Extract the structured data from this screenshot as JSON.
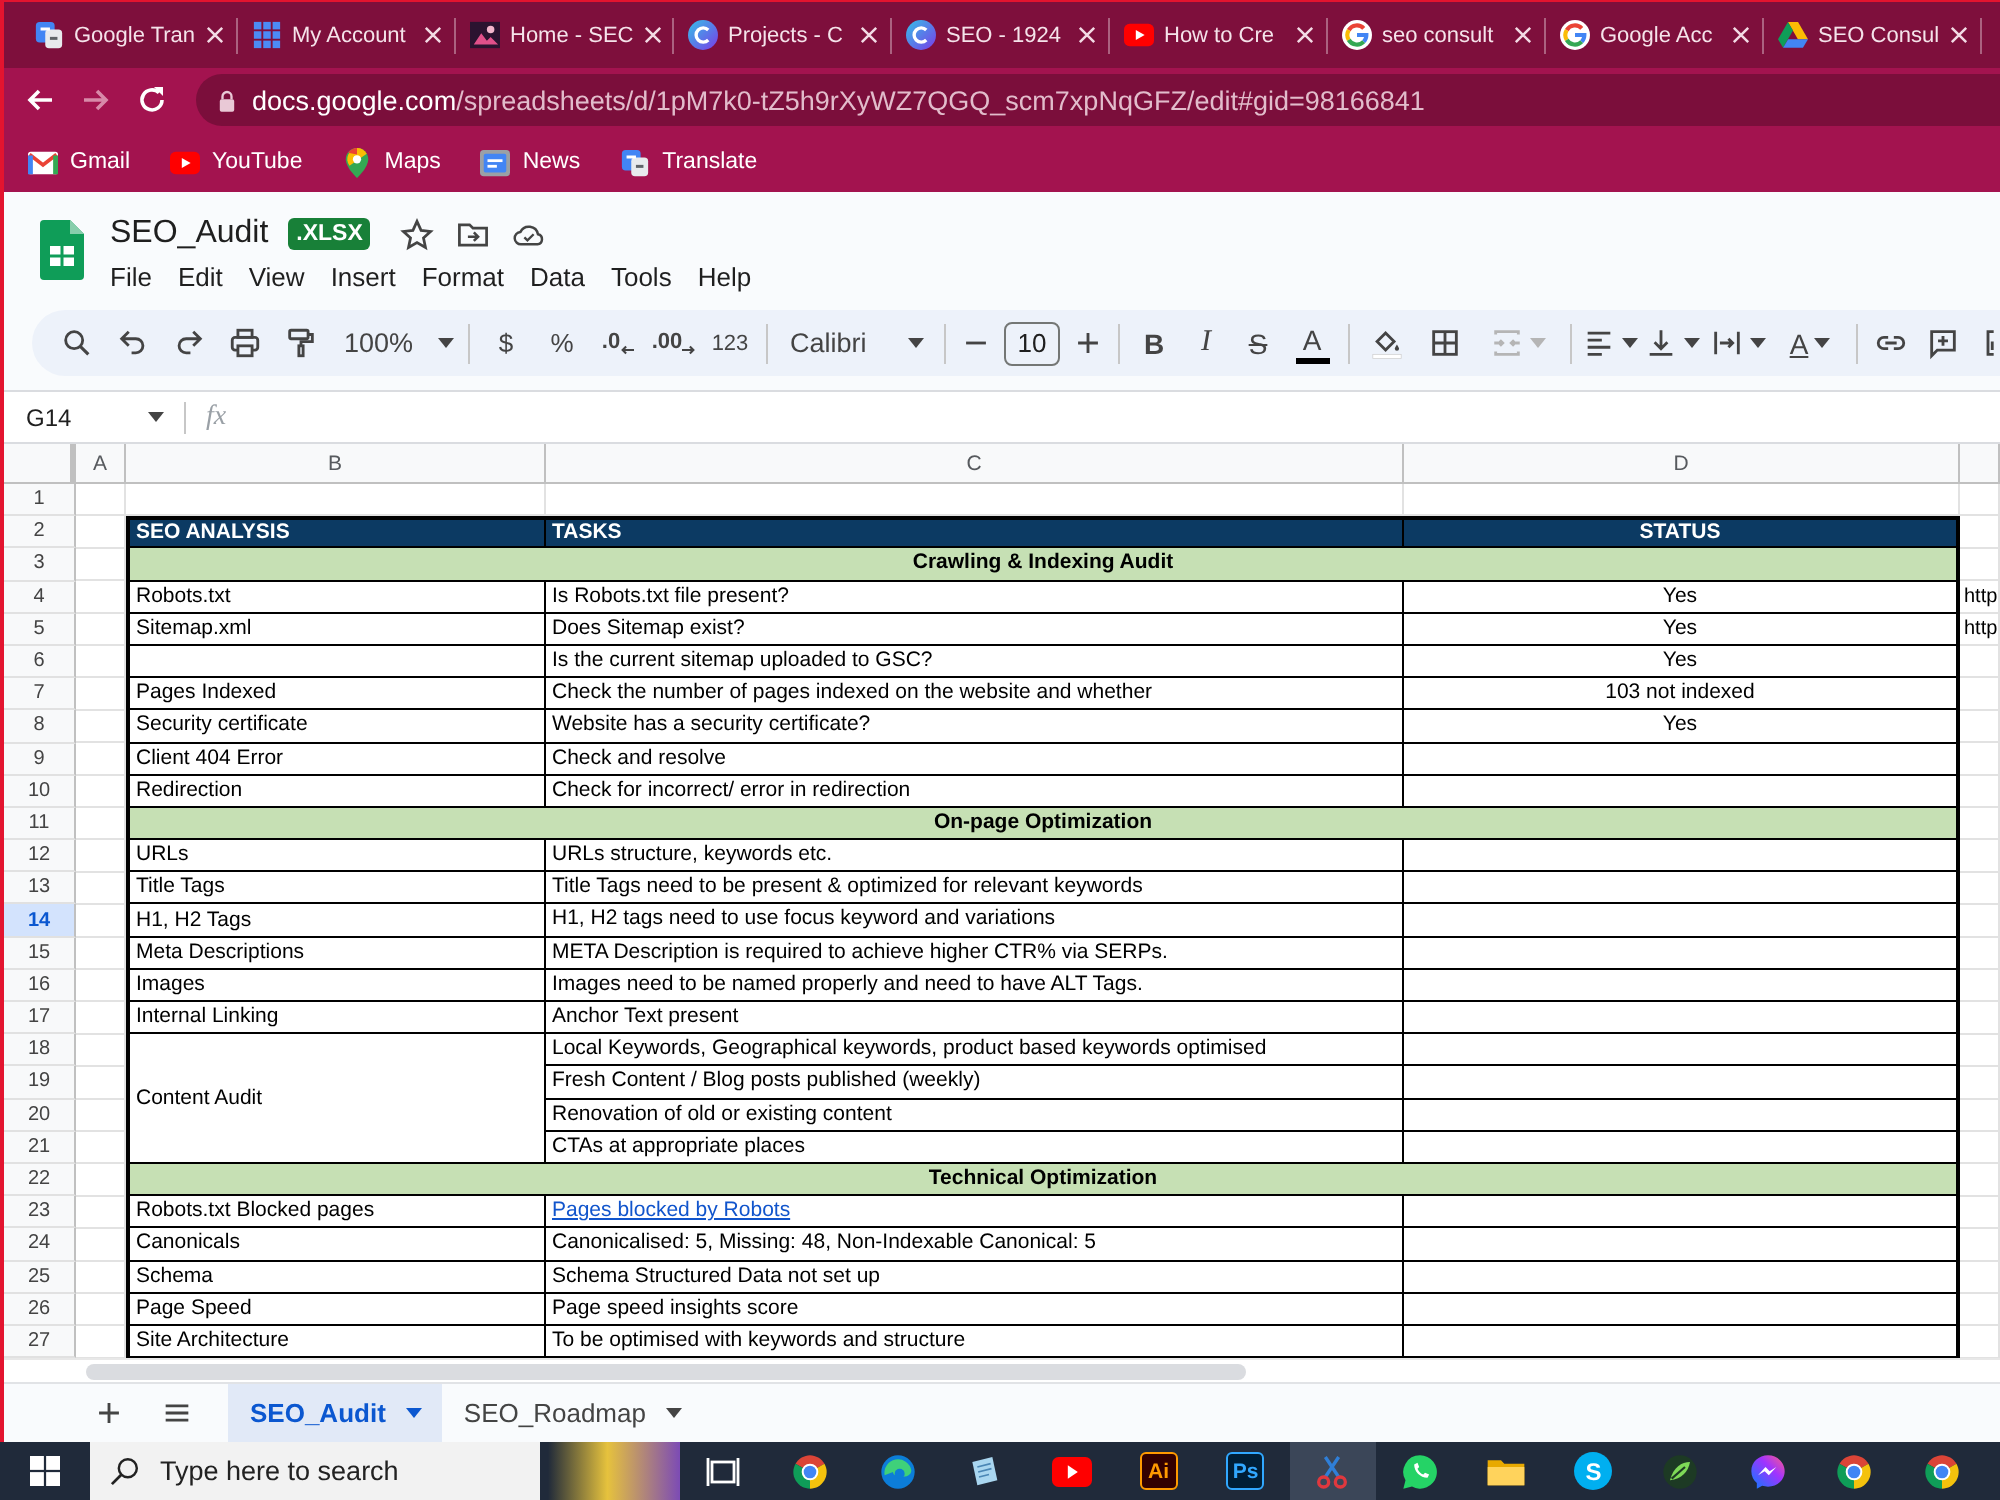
{
  "browser": {
    "tabs": [
      {
        "kind": "translate",
        "title": "Google Tran"
      },
      {
        "kind": "apps-grid",
        "title": "My Account"
      },
      {
        "kind": "photo",
        "title": "Home - SEC"
      },
      {
        "kind": "c-logo",
        "title": "Projects - C"
      },
      {
        "kind": "c-logo",
        "title": "SEO - 1924"
      },
      {
        "kind": "youtube",
        "title": "How to Cre"
      },
      {
        "kind": "google",
        "title": "seo consult"
      },
      {
        "kind": "google",
        "title": "Google Acc"
      },
      {
        "kind": "drive",
        "title": "SEO Consul"
      }
    ],
    "nav": [
      {
        "kind": "back",
        "disabled": false
      },
      {
        "kind": "forward",
        "disabled": true
      },
      {
        "kind": "reload",
        "disabled": false
      }
    ],
    "address": {
      "host": "docs.google.com",
      "path": "/spreadsheets/d/1pM7k0-tZ5h9rXyWZ7QGQ_scm7xpNqGFZ/edit#gid=98166841"
    },
    "bookmarks": [
      {
        "kind": "gmail",
        "label": "Gmail"
      },
      {
        "kind": "youtube",
        "label": "YouTube"
      },
      {
        "kind": "maps",
        "label": "Maps"
      },
      {
        "kind": "news",
        "label": "News"
      },
      {
        "kind": "translate",
        "label": "Translate"
      }
    ]
  },
  "document": {
    "title": "SEO_Audit",
    "badge": ".XLSX",
    "menu": [
      "File",
      "Edit",
      "View",
      "Insert",
      "Format",
      "Data",
      "Tools",
      "Help"
    ]
  },
  "toolbar": {
    "zoom": "100%",
    "currency": "$",
    "percent": "%",
    "decimal_decrease": ".0",
    "decimal_increase": ".00",
    "number_format": "123",
    "font": "Calibri",
    "font_size": "10",
    "bold": "B",
    "italic": "I",
    "strikethrough": "S",
    "text_color": "A",
    "text_rotation": "A",
    "merge": {
      "disabled": true
    }
  },
  "formula_bar": {
    "name_box": "G14",
    "fx": "fx"
  },
  "grid": {
    "columns": [
      "A",
      "B",
      "C",
      "D"
    ],
    "rows": [
      {
        "label": "1",
        "selected": false
      },
      {
        "label": "2",
        "selected": false
      },
      {
        "label": "3",
        "selected": false
      },
      {
        "label": "4",
        "selected": false
      },
      {
        "label": "5",
        "selected": false
      },
      {
        "label": "6",
        "selected": false
      },
      {
        "label": "7",
        "selected": false
      },
      {
        "label": "8",
        "selected": false
      },
      {
        "label": "9",
        "selected": false
      },
      {
        "label": "10",
        "selected": false
      },
      {
        "label": "11",
        "selected": false
      },
      {
        "label": "12",
        "selected": false
      },
      {
        "label": "13",
        "selected": false
      },
      {
        "label": "14",
        "selected": true
      },
      {
        "label": "15",
        "selected": false
      },
      {
        "label": "16",
        "selected": false
      },
      {
        "label": "17",
        "selected": false
      },
      {
        "label": "18",
        "selected": false
      },
      {
        "label": "19",
        "selected": false
      },
      {
        "label": "20",
        "selected": false
      },
      {
        "label": "21",
        "selected": false
      },
      {
        "label": "22",
        "selected": false
      },
      {
        "label": "23",
        "selected": false
      },
      {
        "label": "24",
        "selected": false
      },
      {
        "label": "25",
        "selected": false
      },
      {
        "label": "26",
        "selected": false
      },
      {
        "label": "27",
        "selected": false
      }
    ]
  },
  "table": {
    "header": [
      "SEO ANALYSIS",
      "TASKS",
      "STATUS"
    ],
    "sections": [
      {
        "title": "Crawling & Indexing Audit",
        "items": [
          {
            "analysis": "Robots.txt",
            "tasks": [
              {
                "kind": "text",
                "task": "Is Robots.txt file present?",
                "status": "Yes",
                "column_5": "http"
              }
            ]
          },
          {
            "analysis": "Sitemap.xml",
            "tasks": [
              {
                "kind": "text",
                "task": "Does Sitemap exist?",
                "status": "Yes",
                "column_5": "http"
              }
            ]
          },
          {
            "tasks": [
              {
                "kind": "text",
                "task": "Is the current sitemap uploaded to GSC?",
                "status": "Yes"
              }
            ]
          },
          {
            "analysis": "Pages Indexed",
            "tasks": [
              {
                "kind": "text",
                "task": "Check the number of pages indexed on the website and whether",
                "status": "103 not indexed"
              }
            ]
          },
          {
            "analysis": "Security certificate",
            "tasks": [
              {
                "kind": "text",
                "task": "Website has a security certificate?",
                "status": "Yes"
              }
            ]
          },
          {
            "analysis": "Client 404 Error",
            "tasks": [
              {
                "kind": "text",
                "task": "Check and resolve"
              }
            ]
          },
          {
            "analysis": "Redirection",
            "tasks": [
              {
                "kind": "text",
                "task": "Check for incorrect/ error in redirection"
              }
            ]
          }
        ]
      },
      {
        "title": "On-page Optimization",
        "items": [
          {
            "analysis": "URLs",
            "tasks": [
              {
                "kind": "text",
                "task": "URLs structure, keywords etc."
              }
            ]
          },
          {
            "analysis": "Title Tags",
            "tasks": [
              {
                "kind": "text",
                "task": "Title Tags need to be present & optimized for relevant keywords"
              }
            ]
          },
          {
            "analysis": "H1, H2 Tags",
            "tasks": [
              {
                "kind": "text",
                "task": "H1, H2 tags need to use focus keyword and variations"
              }
            ]
          },
          {
            "analysis": "Meta Descriptions",
            "tasks": [
              {
                "kind": "text",
                "task": "META Description is required to achieve higher CTR% via SERPs."
              }
            ]
          },
          {
            "analysis": "Images",
            "tasks": [
              {
                "kind": "text",
                "task": "Images need to be named properly and need to have ALT Tags."
              }
            ]
          },
          {
            "analysis": "Internal Linking",
            "tasks": [
              {
                "kind": "text",
                "task": "Anchor Text present"
              }
            ]
          },
          {
            "analysis": "Content Audit",
            "tasks": [
              {
                "kind": "text",
                "task": "Local Keywords, Geographical keywords, product based keywords optimised"
              },
              {
                "kind": "text",
                "task": "Fresh Content / Blog posts published (weekly)"
              },
              {
                "kind": "text",
                "task": "Renovation of old or existing content"
              },
              {
                "kind": "text",
                "task": "CTAs at appropriate places"
              }
            ]
          }
        ]
      },
      {
        "title": "Technical Optimization",
        "items": [
          {
            "analysis": "Robots.txt Blocked pages",
            "tasks": [
              {
                "kind": "link",
                "task": "Pages blocked by Robots"
              }
            ]
          },
          {
            "analysis": "Canonicals",
            "tasks": [
              {
                "kind": "text",
                "task": "Canonicalised: 5, Missing: 48, Non-Indexable Canonical: 5"
              }
            ]
          },
          {
            "analysis": "Schema",
            "tasks": [
              {
                "kind": "text",
                "task": "Schema Structured Data not set up"
              }
            ]
          },
          {
            "analysis": "Page Speed",
            "tasks": [
              {
                "kind": "text",
                "task": "Page speed insights score"
              }
            ]
          },
          {
            "analysis": "Site Architecture",
            "tasks": [
              {
                "kind": "text",
                "task": "To be optimised with keywords and structure"
              }
            ]
          }
        ]
      }
    ]
  },
  "sheet_tabs": [
    {
      "label": "SEO_Audit",
      "selected": true
    },
    {
      "label": "SEO_Roadmap",
      "selected": false
    }
  ],
  "taskbar": {
    "search_placeholder": "Type here to search",
    "apps": [
      {
        "kind": "task-view",
        "active": false
      },
      {
        "kind": "chrome",
        "active": false
      },
      {
        "kind": "edge",
        "active": false
      },
      {
        "kind": "notepad",
        "active": false
      },
      {
        "kind": "youtube",
        "active": false
      },
      {
        "kind": "illustrator",
        "glyph": "Ai",
        "active": false
      },
      {
        "kind": "photoshop",
        "glyph": "Ps",
        "active": false
      },
      {
        "kind": "snip",
        "active": true
      },
      {
        "kind": "whatsapp",
        "active": false
      },
      {
        "kind": "folder",
        "active": false
      },
      {
        "kind": "skype",
        "glyph": "S",
        "active": false
      },
      {
        "kind": "leaf",
        "active": false
      },
      {
        "kind": "messenger",
        "active": false
      },
      {
        "kind": "chrome",
        "active": false
      },
      {
        "kind": "chrome",
        "active": false
      }
    ]
  }
}
